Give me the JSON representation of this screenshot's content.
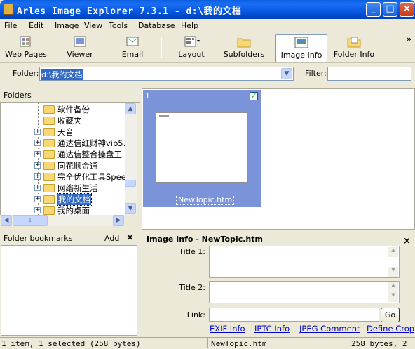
{
  "window": {
    "title": "Arles Image Explorer 7.3.1 - d:\\我的文档"
  },
  "menu": [
    "File",
    "Edit",
    "Image",
    "View",
    "Tools",
    "Database",
    "Help"
  ],
  "toolbar": {
    "items": [
      {
        "label": "Web Pages",
        "icon": "web-pages-icon"
      },
      {
        "label": "Viewer",
        "icon": "viewer-icon"
      },
      {
        "label": "Email",
        "icon": "email-icon"
      },
      {
        "label": "Layout",
        "icon": "layout-icon"
      },
      {
        "label": "Subfolders",
        "icon": "subfolders-icon"
      },
      {
        "label": "Image Info",
        "icon": "image-info-icon"
      },
      {
        "label": "Folder Info",
        "icon": "folder-info-icon"
      }
    ],
    "overflow": "»"
  },
  "address": {
    "folder_label": "Folder:",
    "folder_value": "d:\\我的文档",
    "filter_label": "Filter:",
    "filter_value": ""
  },
  "folders": {
    "header": "Folders",
    "items": [
      {
        "label": "软件备份",
        "expandable": false,
        "selected": false
      },
      {
        "label": "收藏夹",
        "expandable": false,
        "selected": false
      },
      {
        "label": "天音",
        "expandable": true,
        "selected": false
      },
      {
        "label": "通达信红财神vip5.",
        "expandable": true,
        "selected": false
      },
      {
        "label": "通达信整合操盘王",
        "expandable": true,
        "selected": false
      },
      {
        "label": "同花顺金通",
        "expandable": true,
        "selected": false
      },
      {
        "label": "完全优化工具Spee",
        "expandable": true,
        "selected": false
      },
      {
        "label": "网络新生活",
        "expandable": true,
        "selected": false
      },
      {
        "label": "我的文档",
        "expandable": true,
        "selected": true
      },
      {
        "label": "我的桌面",
        "expandable": true,
        "selected": false
      }
    ]
  },
  "bookmarks": {
    "header": "Folder bookmarks",
    "add_label": "Add",
    "close": "×"
  },
  "gallery": {
    "index": "1",
    "checked": true,
    "filename": "NewTopic.htm"
  },
  "info": {
    "header": "Image Info - NewTopic.htm",
    "close": "×",
    "title1_label": "Title 1:",
    "title2_label": "Title 2:",
    "link_label": "Link:",
    "go_label": "Go",
    "links": [
      "EXIF Info",
      "IPTC Info",
      "JPEG Comment",
      "Define Crop"
    ]
  },
  "status": {
    "left": "1 item, 1 selected (258 bytes)",
    "mid": "NewTopic.htm",
    "right": "258 bytes, 2"
  }
}
